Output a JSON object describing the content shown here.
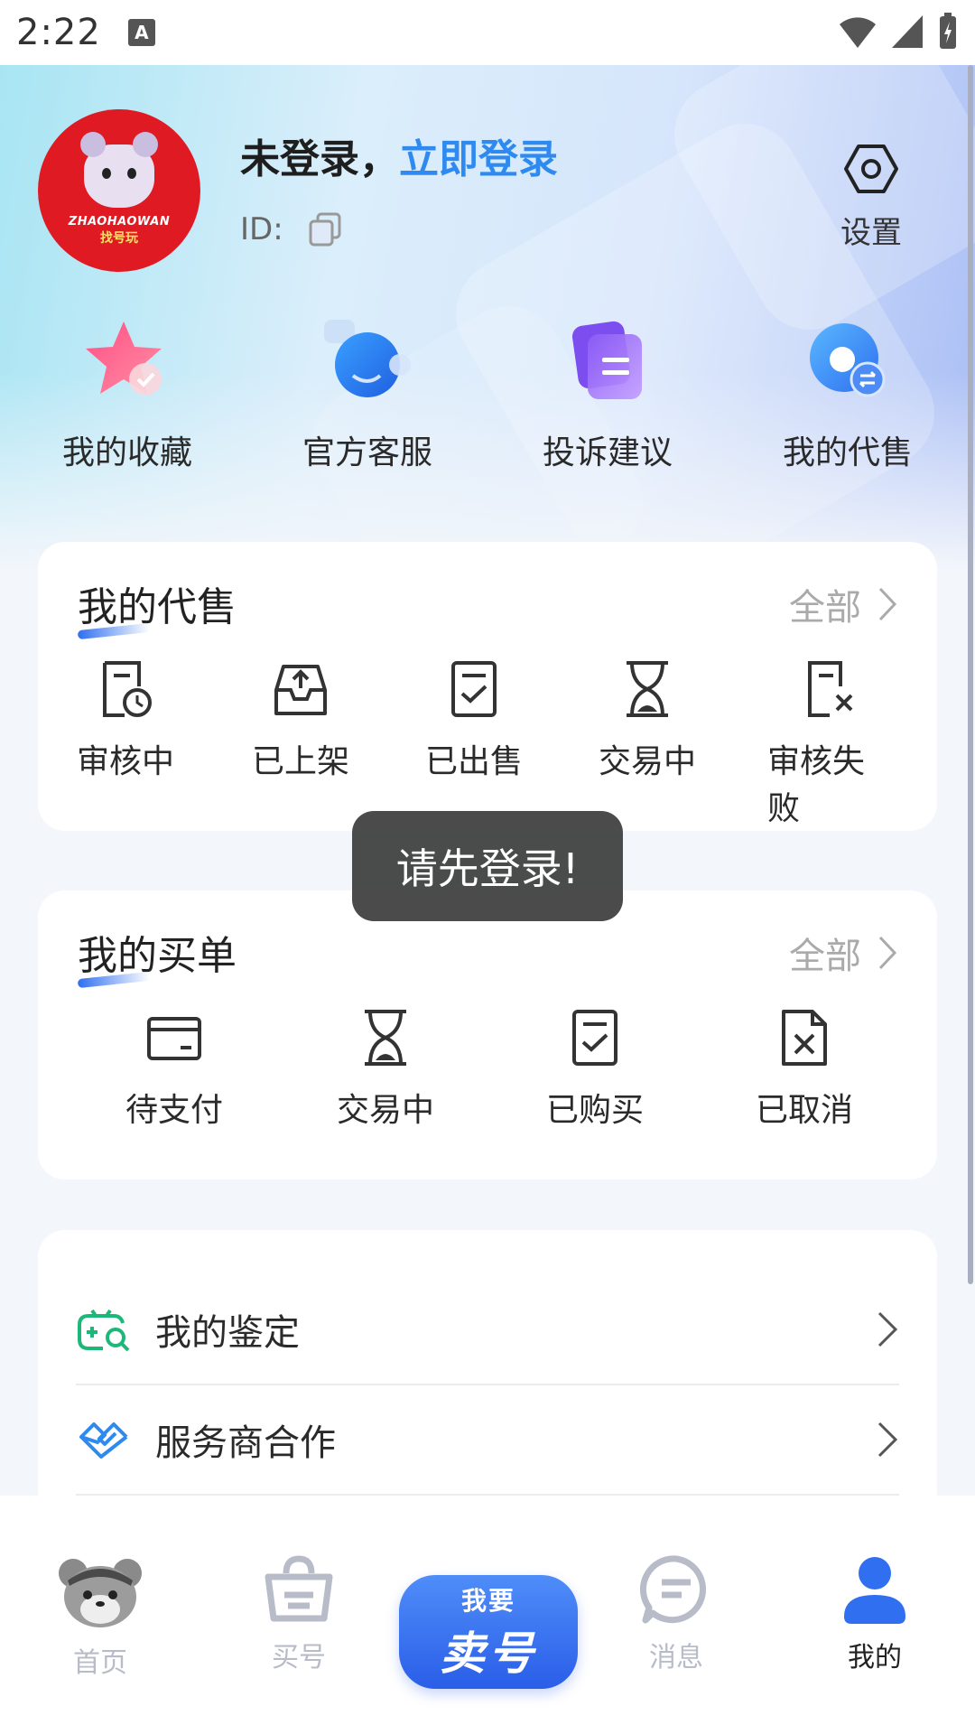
{
  "status_bar": {
    "time": "2:22",
    "a_badge": "A"
  },
  "header": {
    "login_prefix": "未登录，",
    "login_link": "立即登录",
    "id_label": "ID:",
    "settings_label": "设置",
    "avatar_text_1": "ZHAOHAOWAN",
    "avatar_text_2": "找号玩"
  },
  "quick_links": [
    {
      "label": "我的收藏",
      "icon": "star-icon"
    },
    {
      "label": "官方客服",
      "icon": "customer-service-icon"
    },
    {
      "label": "投诉建议",
      "icon": "complaint-icon"
    },
    {
      "label": "我的代售",
      "icon": "consignment-icon"
    }
  ],
  "consignment_card": {
    "title": "我的代售",
    "more": "全部",
    "items": [
      {
        "label": "审核中",
        "icon": "doc-clock-icon"
      },
      {
        "label": "已上架",
        "icon": "tray-upload-icon"
      },
      {
        "label": "已出售",
        "icon": "doc-check-icon"
      },
      {
        "label": "交易中",
        "icon": "hourglass-icon"
      },
      {
        "label": "审核失败",
        "icon": "doc-x-icon"
      }
    ]
  },
  "orders_card": {
    "title": "我的买单",
    "more": "全部",
    "items": [
      {
        "label": "待支付",
        "icon": "card-icon"
      },
      {
        "label": "交易中",
        "icon": "hourglass-icon"
      },
      {
        "label": "已购买",
        "icon": "doc-check-icon"
      },
      {
        "label": "已取消",
        "icon": "file-x-icon"
      }
    ]
  },
  "menu_list": [
    {
      "label": "我的鉴定",
      "icon": "gamepad-search-icon"
    },
    {
      "label": "服务商合作",
      "icon": "handshake-icon"
    }
  ],
  "toast": "请先登录!",
  "tabbar": {
    "home": "首页",
    "buy": "买号",
    "sell_top": "我要",
    "sell_bottom": "卖号",
    "messages": "消息",
    "mine": "我的",
    "active_color": "#2f6ff0"
  }
}
